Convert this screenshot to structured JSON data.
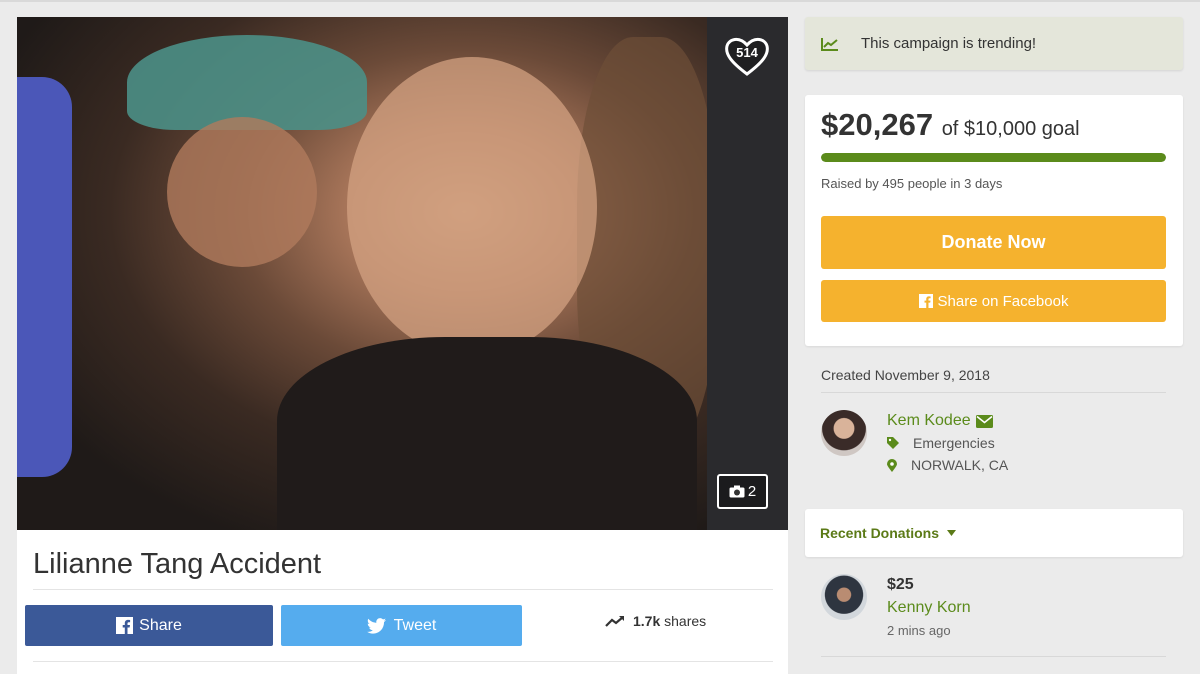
{
  "campaign": {
    "title": "Lilianne Tang Accident",
    "hearts": "514",
    "photo_count": "2"
  },
  "share_bar": {
    "share_label": "Share",
    "tweet_label": "Tweet",
    "shares_count": "1.7k",
    "shares_label": "shares"
  },
  "trending": {
    "text": "This campaign is trending!"
  },
  "goal": {
    "raised": "$20,267",
    "of_goal": "of $10,000 goal",
    "progress_fraction": 1.0,
    "raised_by": "Raised by 495 people in 3 days",
    "donate_label": "Donate Now",
    "facebook_label": "Share on Facebook"
  },
  "organizer": {
    "created": "Created November 9, 2018",
    "name": "Kem Kodee",
    "category": "Emergencies",
    "location": "NORWALK, CA"
  },
  "recent_donations": {
    "header": "Recent Donations",
    "items": [
      {
        "amount": "$25",
        "name": "Kenny Korn",
        "time": "2 mins ago"
      }
    ]
  },
  "colors": {
    "accent_green": "#5b8b1b",
    "donate_orange": "#f5b22e",
    "facebook_blue": "#3b5998",
    "twitter_blue": "#55acee"
  },
  "icons": [
    "heart-icon",
    "camera-icon",
    "facebook-icon",
    "twitter-icon",
    "trending-icon",
    "envelope-icon",
    "tag-icon",
    "map-marker-icon",
    "caret-down-icon"
  ]
}
